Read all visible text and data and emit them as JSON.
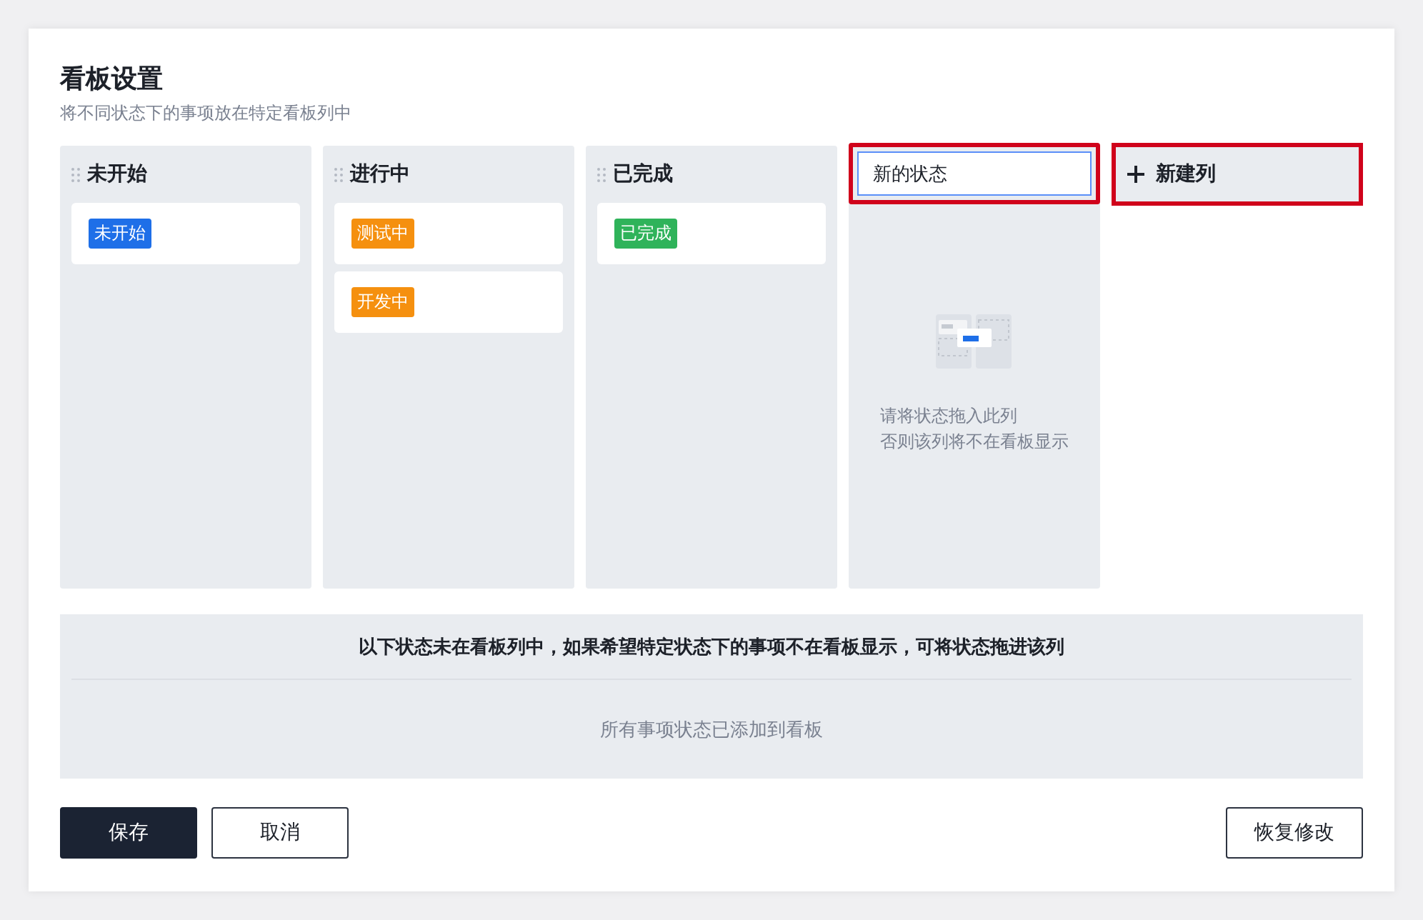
{
  "title": "看板设置",
  "subtitle": "将不同状态下的事项放在特定看板列中",
  "columns": [
    {
      "kind": "status",
      "name": "未开始",
      "cards": [
        {
          "label": "未开始",
          "color": "#1e6fe8"
        }
      ]
    },
    {
      "kind": "status",
      "name": "进行中",
      "cards": [
        {
          "label": "测试中",
          "color": "#f5900f"
        },
        {
          "label": "开发中",
          "color": "#f5900f"
        }
      ]
    },
    {
      "kind": "status",
      "name": "已完成",
      "cards": [
        {
          "label": "已完成",
          "color": "#2fb35a"
        }
      ]
    },
    {
      "kind": "new",
      "value": "新的状态",
      "highlighted": true,
      "empty_text": [
        "请将状态拖入此列",
        "否则该列将不在看板显示"
      ]
    }
  ],
  "add_column": {
    "label": "新建列",
    "highlighted": true
  },
  "unassigned": {
    "heading": "以下状态未在看板列中，如果希望特定状态下的事项不在看板显示，可将状态拖进该列",
    "empty_text": "所有事项状态已添加到看板"
  },
  "buttons": [
    {
      "label": "保存",
      "kind": "primary"
    },
    {
      "label": "取消",
      "kind": "default"
    },
    {
      "label": "恢复修改",
      "kind": "secondary"
    }
  ]
}
